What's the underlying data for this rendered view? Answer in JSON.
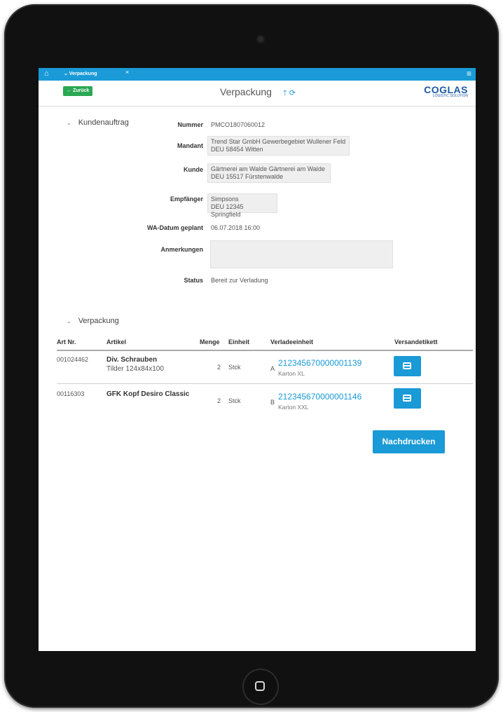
{
  "topbar": {
    "home_icon": "home-icon",
    "tab_label": "⌄ Verpackung",
    "tab_close": "×",
    "menu_icon": "hamburger-icon",
    "color": "#1a9ad6"
  },
  "header": {
    "back_label": "← Zurück",
    "title": "Verpackung",
    "logo_name": "COGLAS",
    "logo_sub": "LOGISTIC SOLUTION"
  },
  "kundenauftrag": {
    "section_title": "Kundenauftrag",
    "nummer_label": "Nummer",
    "nummer_value": "PMCO1807060012",
    "mandant_label": "Mandant",
    "mandant_line1": "Trend Star GmbH Gewerbegebiet Wullener Feld",
    "mandant_line2": "DEU 58454 Witten",
    "kunde_label": "Kunde",
    "kunde_line1": "Gärtnerei am Walde Gärtnerei am Walde",
    "kunde_line2": "DEU 15517 Fürstenwalde",
    "empfaenger_label": "Empfänger",
    "empfaenger_line1": "Simpsons",
    "empfaenger_line2": "DEU 12345 Springfield",
    "wa_label": "WA-Datum geplant",
    "wa_value": "06.07.2018 16:00",
    "anmerkungen_label": "Anmerkungen",
    "anmerkungen_value": "",
    "status_label": "Status",
    "status_value": "Bereit zur Verladung"
  },
  "verpackung": {
    "section_title": "Verpackung",
    "columns": {
      "art_nr": "Art Nr.",
      "artikel": "Artikel",
      "menge": "Menge",
      "einheit": "Einheit",
      "verladeeinheit": "Verladeeinheit",
      "versandetikett": "Versandetikett"
    },
    "rows": [
      {
        "art_nr": "001024462",
        "artikel": "Div. Schrauben",
        "artikel_sub": "Tilder 124x84x100",
        "menge": "2",
        "einheit": "Stck",
        "lu_letter": "A",
        "lu_number": "212345670000001139",
        "lu_type": "Karton XL"
      },
      {
        "art_nr": "00116303",
        "artikel": "GFK Kopf Desiro Classic",
        "artikel_sub": "",
        "menge": "2",
        "einheit": "Stck",
        "lu_letter": "B",
        "lu_number": "212345670000001146",
        "lu_type": "Karton XXL"
      }
    ],
    "reprint_label": "Nachdrucken"
  }
}
